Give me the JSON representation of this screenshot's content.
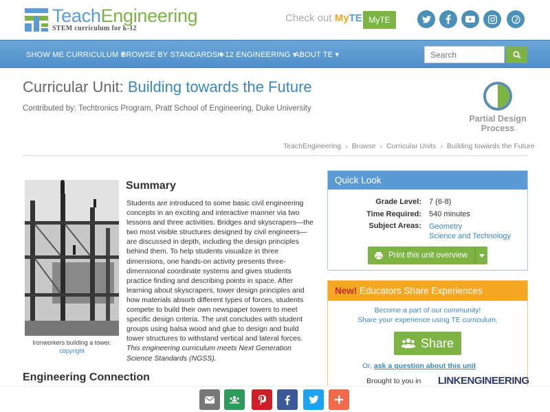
{
  "header": {
    "logo_name": "TeachEngineering",
    "logo_name_part1": "Teach",
    "logo_name_part2": "Engineering",
    "logo_sub": "STEM curriculum for k-12",
    "checkout_text": "Check out ",
    "checkout_my": "My",
    "checkout_te": "TE",
    "myte_button": "MyTE",
    "social_icons": [
      "twitter-icon",
      "facebook-icon",
      "youtube-icon",
      "instagram-icon",
      "pinterest-icon"
    ],
    "social_color": "#4a90b8"
  },
  "nav": {
    "items": [
      {
        "label": "SHOW ME CURRICULUM"
      },
      {
        "label": "BROWSE BY STANDARDS"
      },
      {
        "label": "K-12 ENGINEERING"
      },
      {
        "label": "ABOUT TE"
      }
    ],
    "search_placeholder": "Search",
    "bg_color": "#5a9bd5",
    "accent_green": "#7cb342"
  },
  "page": {
    "title_prefix": "Curricular Unit: ",
    "title": "Building towards the Future",
    "contributed": "Contributed by: Techtronics Program, Pratt School of Engineering, Duke University",
    "design_process_label": "Partial Design Process",
    "design_process_line1": "Partial Design",
    "design_process_line2": "Process",
    "breadcrumb": [
      "TeachEngineering",
      "Browse",
      "Curricular Units",
      "Building towards the Future"
    ]
  },
  "summary": {
    "photo_caption": "Ironworkers building a tower.",
    "photo_copyright": "copyright",
    "heading": "Summary",
    "body": "Students are introduced to some basic civil engineering concepts in an exciting and interactive manner via two lessons and three activities. Bridges and skyscrapers—the two most visible structures designed by civil engineers—are discussed in depth, including the design principles behind them. To help students visualize in three dimensions, one hands-on activity presents three-dimensional coordinate systems and gives students practice finding and describing points in space. After learning about skyscrapers, tower design principles and how materials absorb different types of forces, students compete to build their own newspaper towers to meet specific design criteria. The unit concludes with student groups using balsa wood and glue to design and build tower structures to withstand vertical and lateral forces.",
    "ngss_note": "This engineering curriculum meets Next Generation Science Standards (NGSS).",
    "engineering_connection": "Engineering Connection"
  },
  "quick_look": {
    "heading": "Quick Look",
    "grade_key": "Grade Level:",
    "grade_val": "7 (6-8)",
    "time_key": "Time Required:",
    "time_val": "540 minutes",
    "subjects_key": "Subject Areas:",
    "subjects": [
      "Geometry",
      "Science and Technology"
    ],
    "print_button": "Print this unit overview"
  },
  "educators": {
    "new_label": "New!",
    "heading": " Educators Share Experiences",
    "line1": "Become a part of our community!",
    "line2": "Share your experience using TE curriculum.",
    "share_button": "Share",
    "or_text": "Or, ",
    "ask_link": "ask a question about this unit",
    "brought_by": "Brought to you in",
    "partner_logo": "LINKENGINEERING"
  },
  "share_bar": {
    "buttons": [
      {
        "icon": "email-icon",
        "color": "#777777"
      },
      {
        "icon": "google-classroom-icon",
        "color": "#2e9a5b"
      },
      {
        "icon": "pinterest-icon",
        "color": "#cb2027"
      },
      {
        "icon": "facebook-icon",
        "color": "#3b5998"
      },
      {
        "icon": "twitter-icon",
        "color": "#1da1f2"
      },
      {
        "icon": "more-icon",
        "color": "#f06a4b"
      }
    ]
  }
}
